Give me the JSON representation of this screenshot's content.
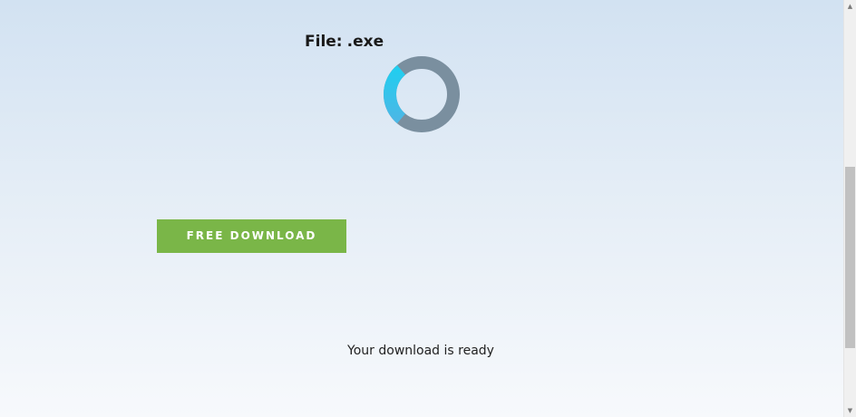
{
  "file_info": {
    "label": "File:",
    "filename": ".exe"
  },
  "spinner": {
    "icon": "loading-spinner-icon",
    "track_color": "#7a8f9f",
    "accent_color": "#22cdef"
  },
  "download": {
    "button_label": "FREE DOWNLOAD",
    "button_color": "#7ab648"
  },
  "status": {
    "message": "Your download is ready"
  },
  "scrollbar": {
    "up_icon": "▲",
    "down_icon": "▼"
  }
}
